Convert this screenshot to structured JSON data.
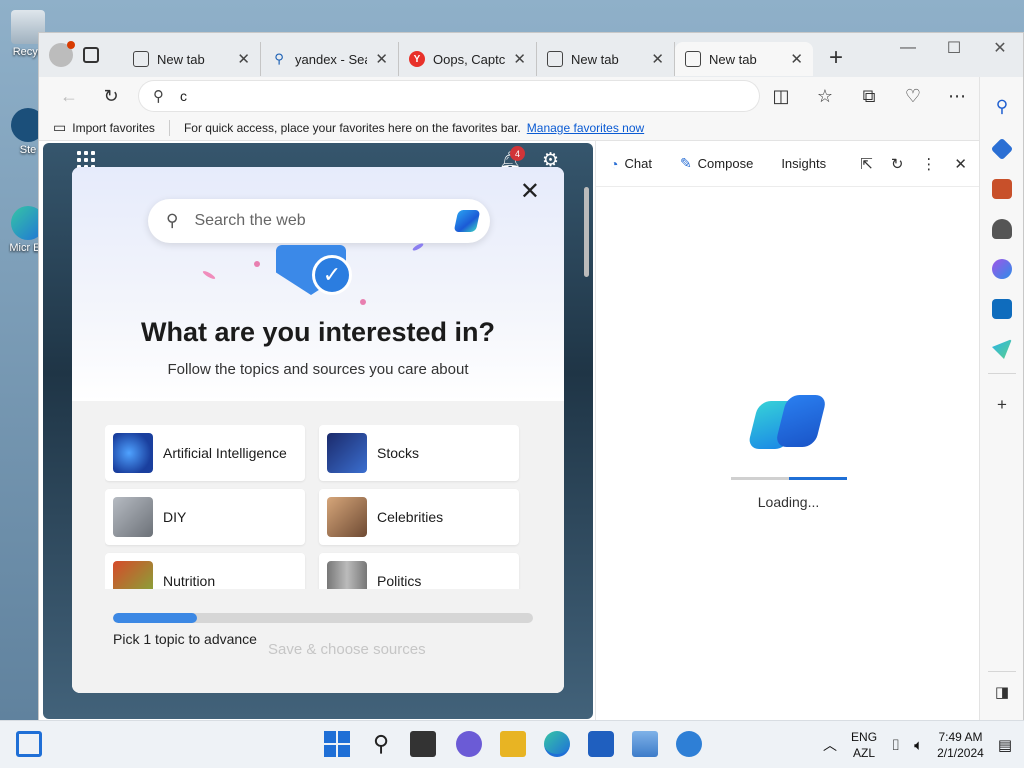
{
  "desktop": {
    "icons": [
      {
        "label": "Recyc"
      },
      {
        "label": "Ste"
      },
      {
        "label": "Micr Ed"
      }
    ]
  },
  "browser": {
    "tabs": [
      {
        "title": "New tab",
        "icon": "newtab-icon",
        "active": false
      },
      {
        "title": "yandex - Sear",
        "icon": "search-icon",
        "active": false
      },
      {
        "title": "Oops, Captch",
        "icon": "yandex-icon",
        "active": false
      },
      {
        "title": "New tab",
        "icon": "newtab-icon",
        "active": false
      },
      {
        "title": "New tab",
        "icon": "newtab-icon",
        "active": true
      }
    ],
    "address": {
      "value": "c"
    },
    "favorites_bar": {
      "import_label": "Import favorites",
      "message": "For quick access, place your favorites here on the favorites bar.",
      "manage_link": "Manage favorites now"
    }
  },
  "new_tab_page": {
    "notification_count": "4",
    "modal": {
      "search_placeholder": "Search the web",
      "title": "What are you interested in?",
      "subtitle": "Follow the topics and sources you care about",
      "topics": [
        {
          "label": "Artificial Intelligence",
          "thumb_color": "#1a3f9e"
        },
        {
          "label": "Stocks",
          "thumb_color": "#1b2a6b"
        },
        {
          "label": "DIY",
          "thumb_color": "#8a8f96"
        },
        {
          "label": "Celebrities",
          "thumb_color": "#a0714f"
        },
        {
          "label": "Nutrition",
          "thumb_color": "#c9682a"
        },
        {
          "label": "Politics",
          "thumb_color": "#8c8c8c"
        }
      ],
      "progress_fraction": 0.2,
      "progress_text": "Pick 1 topic to advance",
      "save_button": "Save & choose sources"
    }
  },
  "copilot": {
    "tabs": [
      "Chat",
      "Compose",
      "Insights"
    ],
    "loading_text": "Loading..."
  },
  "taskbar": {
    "language": {
      "line1": "ENG",
      "line2": "AZL"
    },
    "time": "7:49 AM",
    "date": "2/1/2024"
  }
}
